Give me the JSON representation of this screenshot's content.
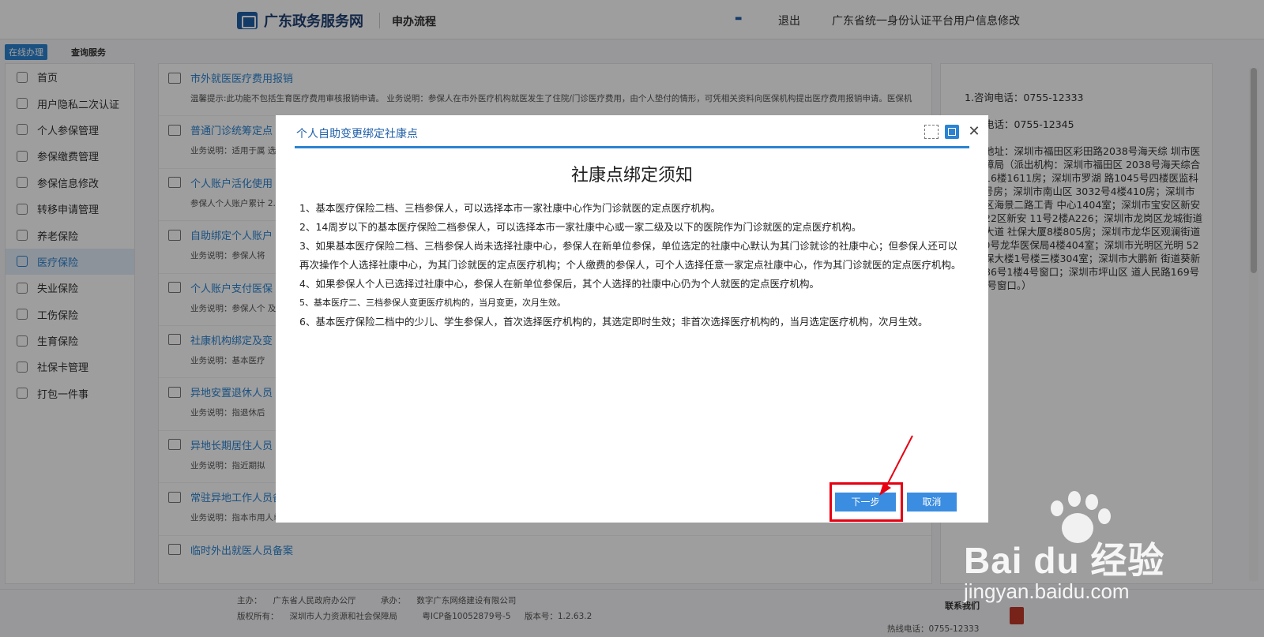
{
  "header": {
    "logo_text": "广东政务服务网",
    "flow_label": "申办流程",
    "exit_label": "退出",
    "account_link": "广东省统一身份认证平台用户信息修改"
  },
  "topbar": {
    "online_tab": "在线办理",
    "query_tab": "查询服务"
  },
  "sidebar": {
    "items": [
      {
        "label": "首页",
        "icon": "home-icon"
      },
      {
        "label": "用户隐私二次认证",
        "icon": "home-icon"
      },
      {
        "label": "个人参保管理",
        "icon": "user-icon"
      },
      {
        "label": "参保缴费管理",
        "icon": "coin-icon"
      },
      {
        "label": "参保信息修改",
        "icon": "edit-icon"
      },
      {
        "label": "转移申请管理",
        "icon": "transfer-icon"
      },
      {
        "label": "养老保险",
        "icon": "document-icon"
      },
      {
        "label": "医疗保险",
        "icon": "user-icon"
      },
      {
        "label": "失业保险",
        "icon": "user-icon"
      },
      {
        "label": "工伤保险",
        "icon": "document-icon"
      },
      {
        "label": "生育保险",
        "icon": "user-icon"
      },
      {
        "label": "社保卡管理",
        "icon": "card-icon"
      },
      {
        "label": "打包一件事",
        "icon": "package-icon"
      }
    ],
    "active_index": 7
  },
  "services": [
    {
      "title": "市外就医医疗费用报销",
      "desc": "温馨提示:此功能不包括生育医疗费用审核报销申请。 业务说明：参保人在市外医疗机构就医发生了住院/门诊医疗费用，由个人垫付的情形，可凭相关资料向医保机构提出医疗费用报销申请。医保机"
    },
    {
      "title": "普通门诊统筹定点",
      "desc": "业务说明：适用于属 选定普通门诊统筹就"
    },
    {
      "title": "个人账户活化使用",
      "desc": "参保人个人账户累计 2.在定点零售药店购"
    },
    {
      "title": "自助绑定个人账户",
      "desc": "业务说明：参保人将"
    },
    {
      "title": "个人账户支付医保",
      "desc": "业务说明：参保人个 及配偶、父母、子女"
    },
    {
      "title": "社康机构绑定及变",
      "desc": "业务说明：基本医疗"
    },
    {
      "title": "异地安置退休人员",
      "desc": "业务说明：指退休后"
    },
    {
      "title": "异地长期居住人员",
      "desc": "业务说明：指近期拟"
    },
    {
      "title": "常驻异地工作人员备案",
      "desc": "业务说明：指本市用人单位长期派驻异地工作的在职职工。"
    },
    {
      "title": "临时外出就医人员备案",
      "desc": ""
    }
  ],
  "info": {
    "lines": [
      "1.咨询电话：0755-12333",
      "投诉电话：0755-12345",
      "投诉地址：深圳市福田区彩田路2038号海天综 圳市医疗保障局（派出机构：深圳市福田区 2038号海天综合大厦16楼1611房；深圳市罗湖 路1045号四楼医监科406号房；深圳市南山区 3032号4楼410房；深圳市盐田区海景二路工青 中心1404室；深圳市宝安区新安街道22区新安 11号2楼A226；深圳市龙岗区龙城街道龙翔大道 社保大厦8楼805房；深圳市龙华区观澜街道碧 00号龙华医保局4楼404室；深圳市光明区光明 52号社保大楼1号楼三楼304室；深圳市大鹏新 街道葵新北路86号1楼4号窗口；深圳市坪山区 道人民路169号1楼1号窗口。）"
    ]
  },
  "footer": {
    "host_label": "主办：",
    "host": "广东省人民政府办公厅",
    "undertake_label": "承办：",
    "undertake": "数字广东网络建设有限公司",
    "copyright_label": "版权所有：",
    "copyright": "深圳市人力资源和社会保障局",
    "icp": "粤ICP备10052879号-5",
    "version": "版本号：1.2.63.2",
    "contact_title": "联系我们",
    "hotline": "热线电话：0755-12333"
  },
  "modal": {
    "title": "个人自助变更绑定社康点",
    "notice_title": "社康点绑定须知",
    "items": [
      "1、基本医疗保险二档、三档参保人，可以选择本市一家社康中心作为门诊就医的定点医疗机构。",
      "2、14周岁以下的基本医疗保险二档参保人，可以选择本市一家社康中心或一家二级及以下的医院作为门诊就医的定点医疗机构。",
      "3、如果基本医疗保险二档、三档参保人尚未选择社康中心，参保人在新单位参保，单位选定的社康中心默认为其门诊就诊的社康中心；但参保人还可以再次操作个人选择社康中心，为其门诊就医的定点医疗机构；个人缴费的参保人，可个人选择任意一家定点社康中心，作为其门诊就医的定点医疗机构。",
      "4、如果参保人个人已选择过社康中心，参保人在新单位参保后，其个人选择的社康中心仍为个人就医的定点医疗机构。",
      "5、基本医疗二、三档参保人变更医疗机构的，当月变更，次月生效。",
      "6、基本医疗保险二档中的少儿、学生参保人，首次选择医疗机构的，其选定即时生效；非首次选择医疗机构的，当月选定医疗机构，次月生效。"
    ],
    "next_label": "下一步",
    "cancel_label": "取消"
  },
  "watermark": {
    "brand": "Bai du 经验",
    "url": "jingyan.baidu.com"
  },
  "colors": {
    "accent": "#2c83d1",
    "highlight": "#e60012"
  }
}
